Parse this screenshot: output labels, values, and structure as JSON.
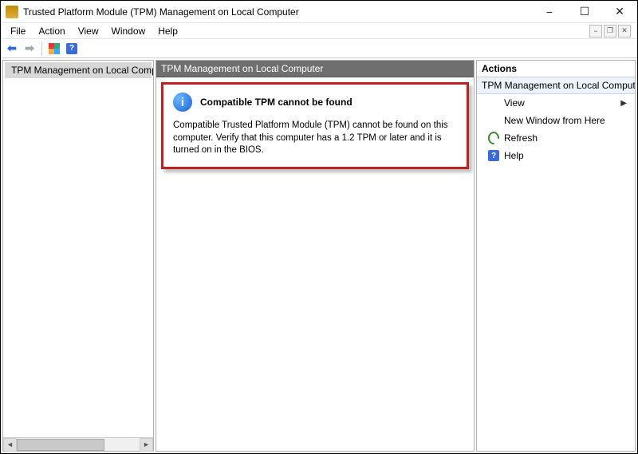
{
  "window": {
    "title": "Trusted Platform Module (TPM) Management on Local Computer"
  },
  "menubar": {
    "items": [
      "File",
      "Action",
      "View",
      "Window",
      "Help"
    ]
  },
  "tree": {
    "items": [
      {
        "label": "TPM Management on Local Comp"
      }
    ]
  },
  "center": {
    "header": "TPM Management on Local Computer",
    "error_title": "Compatible TPM cannot be found",
    "error_body": "Compatible Trusted Platform Module (TPM) cannot be found on this computer. Verify that this computer has a 1.2 TPM or later and it is turned on in the BIOS."
  },
  "actions": {
    "header": "Actions",
    "section": "TPM Management on Local Computer",
    "items": [
      {
        "label": "View",
        "icon": "blank",
        "submenu": true
      },
      {
        "label": "New Window from Here",
        "icon": "blank"
      },
      {
        "label": "Refresh",
        "icon": "refresh"
      },
      {
        "label": "Help",
        "icon": "help"
      }
    ]
  }
}
